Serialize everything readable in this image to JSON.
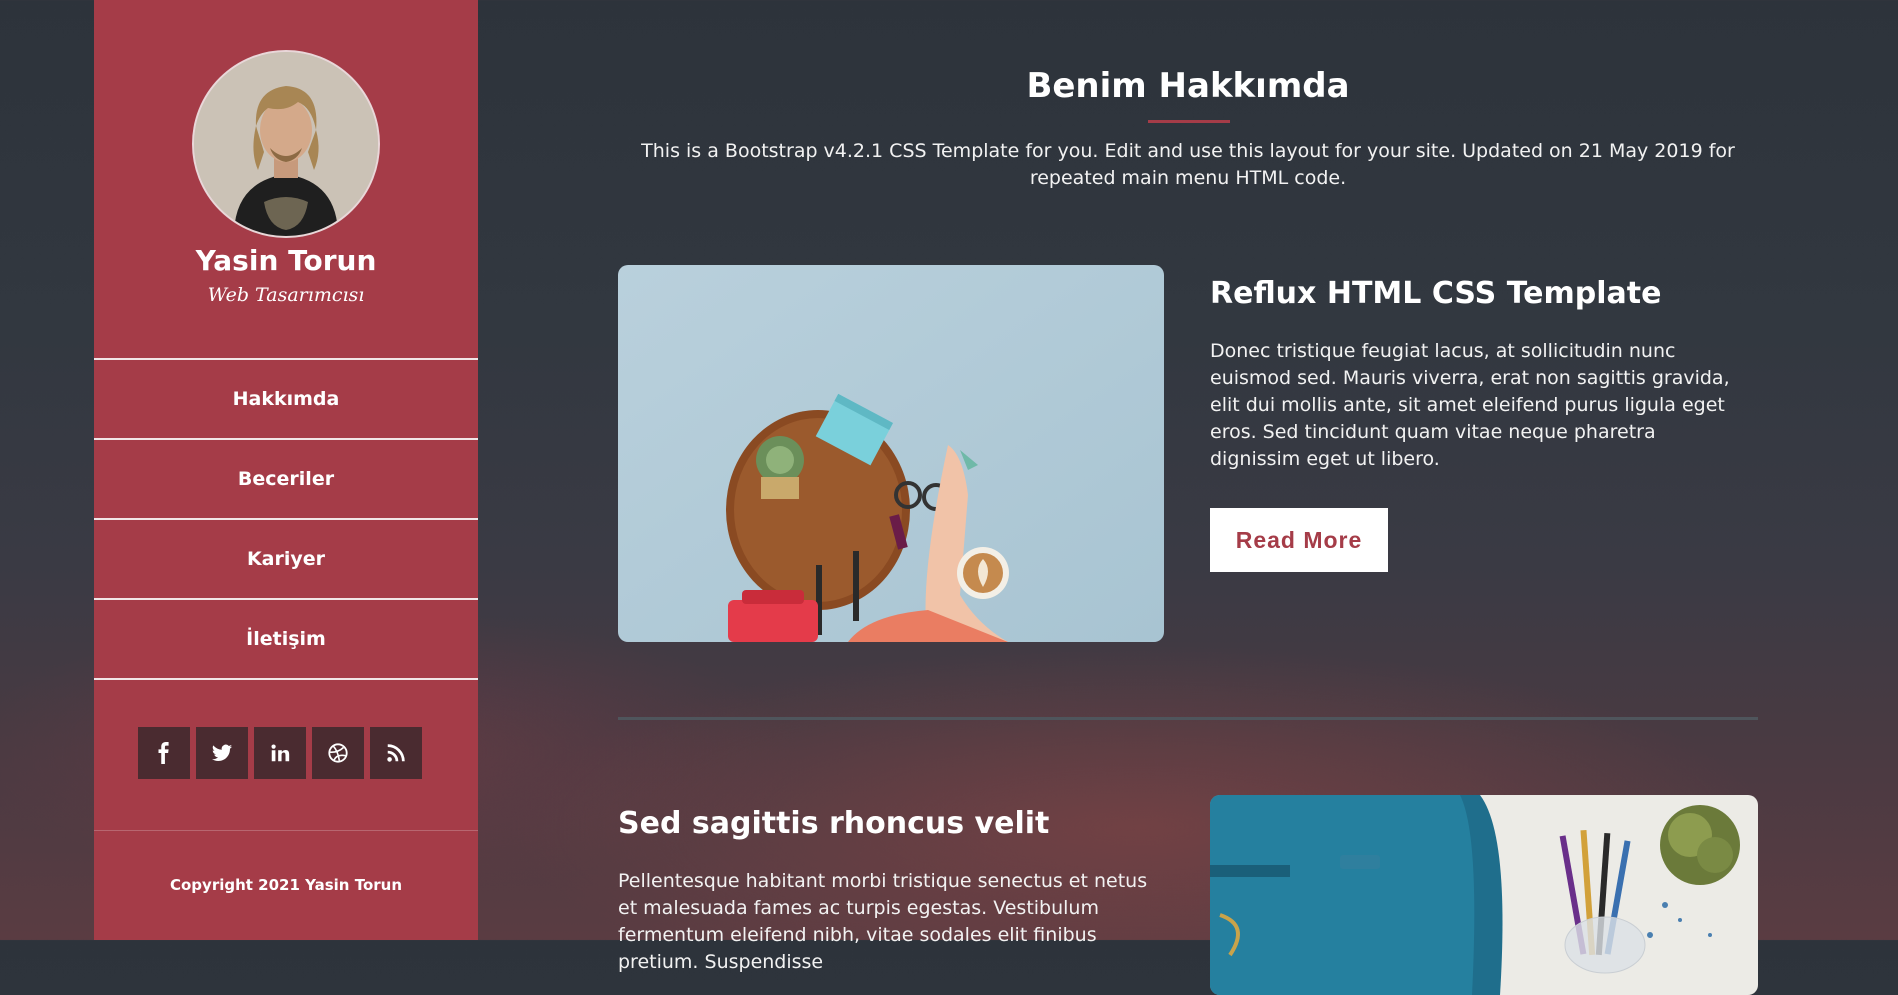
{
  "profile": {
    "name": "Yasin Torun",
    "role": "Web Tasarımcısı"
  },
  "nav": {
    "items": [
      {
        "label": "Hakkımda"
      },
      {
        "label": "Beceriler"
      },
      {
        "label": "Kariyer"
      },
      {
        "label": "İletişim"
      }
    ]
  },
  "social": {
    "icons": [
      "facebook-icon",
      "twitter-icon",
      "linkedin-icon",
      "dribbble-icon",
      "rss-icon"
    ]
  },
  "footer": {
    "copyright": "Copyright 2021 Yasin Torun"
  },
  "about": {
    "title": "Benim Hakkımda",
    "text": "This is a Bootstrap v4.2.1 CSS Template for you. Edit and use this layout for your site. Updated on 21 May 2019 for repeated main menu HTML code."
  },
  "posts": [
    {
      "title": "Reflux HTML CSS Template",
      "body": "Donec tristique feugiat lacus, at sollicitudin nunc euismod sed. Mauris viverra, erat non sagittis gravida, elit dui mollis ante, sit amet eleifend purus ligula eget eros. Sed tincidunt quam vitae neque pharetra dignissim eget ut libero.",
      "button": "Read More"
    },
    {
      "title": "Sed sagittis rhoncus velit",
      "body": "Pellentesque habitant morbi tristique senectus et netus et malesuada fames ac turpis egestas. Vestibulum fermentum eleifend nibh, vitae sodales elit finibus pretium. Suspendisse"
    }
  ],
  "colors": {
    "accent": "#a53c48",
    "social_bg": "#4a2b30",
    "background": "#2d333b"
  }
}
